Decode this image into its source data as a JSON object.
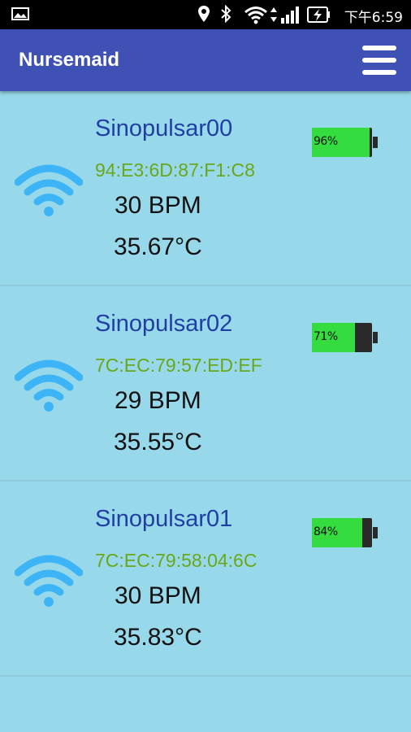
{
  "status_bar": {
    "time": "下午6:59",
    "icons": [
      "image-icon",
      "location-icon",
      "bluetooth-icon",
      "wifi-icon",
      "signal-icon",
      "battery-charging-icon"
    ]
  },
  "app_bar": {
    "title": "Nursemaid",
    "menu_icon": "hamburger-menu-icon"
  },
  "colors": {
    "app_bar": "#3f51b5",
    "background": "#97d9ea",
    "device_name": "#1f3fa4",
    "mac": "#6aa71a",
    "wifi": "#3cb4f5",
    "battery_fill": "#35dc3f"
  },
  "devices": [
    {
      "name": "Sinopulsar00",
      "mac": "94:E3:6D:87:F1:C8",
      "bpm": "30 BPM",
      "temperature": "35.67°C",
      "battery_label": "96%",
      "battery_level": 0.96,
      "icon": "wifi-icon"
    },
    {
      "name": "Sinopulsar02",
      "mac": "7C:EC:79:57:ED:EF",
      "bpm": "29 BPM",
      "temperature": "35.55°C",
      "battery_label": "71%",
      "battery_level": 0.71,
      "icon": "wifi-icon"
    },
    {
      "name": "Sinopulsar01",
      "mac": "7C:EC:79:58:04:6C",
      "bpm": "30 BPM",
      "temperature": "35.83°C",
      "battery_label": "84%",
      "battery_level": 0.84,
      "icon": "wifi-icon"
    }
  ]
}
